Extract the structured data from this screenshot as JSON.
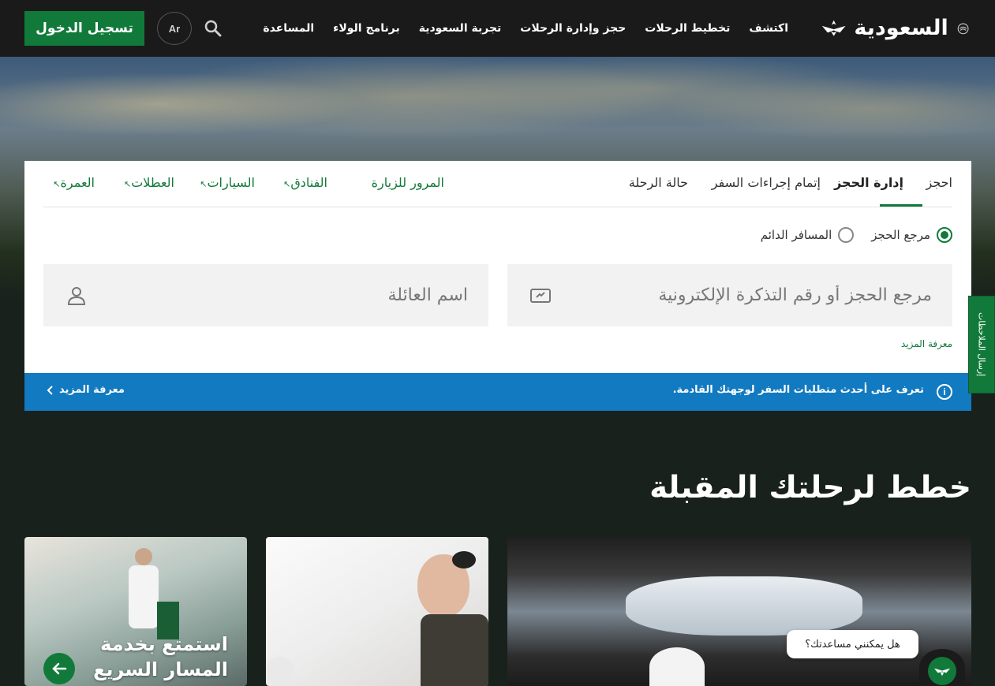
{
  "header": {
    "logo_text": "السعودية",
    "nav": [
      "اكتشف",
      "تخطيط الرحلات",
      "حجز وإدارة الرحلات",
      "تجربة السعودية",
      "برنامج الولاء",
      "المساعدة"
    ],
    "lang": "Ar",
    "login": "تسجيل الدخول"
  },
  "booking": {
    "tabs_main": [
      "احجز",
      "إدارة الحجز",
      "إتمام إجراءات السفر",
      "حالة الرحلة"
    ],
    "tabs_ext": [
      "المرور للزيارة",
      "الفنادق",
      "السيارات",
      "العطلات",
      "العمرة"
    ],
    "radio_ref": "مرجع الحجز",
    "radio_ff": "المسافر الدائم",
    "field_ref_placeholder": "مرجع الحجز أو رقم التذكرة الإلكترونية",
    "field_name_placeholder": "اسم العائلة",
    "learn_more": "معرفة المزيد"
  },
  "info_bar": {
    "text": "تعرف على أحدث متطلبات السفر لوجهتك القادمة.",
    "more": "معرفة المزيد"
  },
  "feedback": "إرسال الملاحظات",
  "section": {
    "title": "خطط لرحلتك المقبلة",
    "card1_line1": "استمتع بخدمة",
    "card1_line2": "المسار السريع"
  },
  "chat": {
    "prompt": "هل يمكنني مساعدتك؟"
  },
  "colors": {
    "brand_green": "#117a3a",
    "info_blue": "#117ac0",
    "header_bg": "#1a1a1a"
  }
}
